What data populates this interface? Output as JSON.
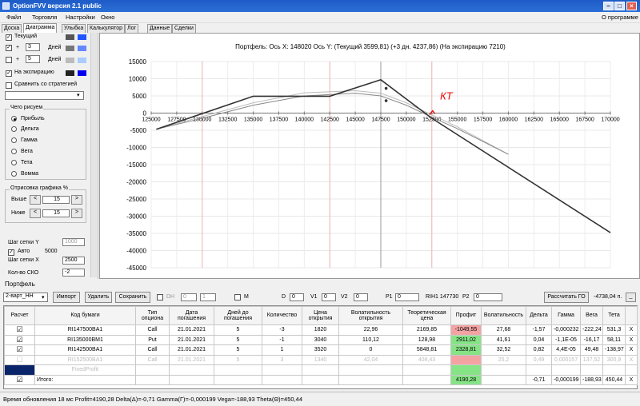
{
  "app": {
    "title": "OptionFVV версия 2.1 public"
  },
  "menu": {
    "file": "Файл",
    "trade": "Торговля",
    "settings": "Настройки",
    "window": "Окно",
    "about": "О программе"
  },
  "tabs": [
    "Доска",
    "Диаграмма",
    "Улыбка",
    "Калькулятор",
    "Лог",
    "Данные",
    "Сделки"
  ],
  "left": {
    "current_label": "Текущий",
    "plus": "+",
    "days_label": "Дней",
    "days1": "3",
    "days2": "5",
    "expiry_label": "На экспирацию",
    "compare_label": "Сравнить со стратегией",
    "compare_value": "",
    "what_draw": "Чего рисуем",
    "radio": [
      "Прибыль",
      "Дельта",
      "Гамма",
      "Вега",
      "Тета",
      "Вомма"
    ],
    "draw_pct": "Отрисовка графика %",
    "above_label": "Выше",
    "above_value": "15",
    "below_label": "Ниже",
    "below_value": "15",
    "btn_left": "<",
    "btn_right": ">",
    "grid_y_label": "Шаг сетки Y",
    "grid_y_value": "1000",
    "auto_label": "Авто",
    "auto_value": "5000",
    "grid_x_label": "Шаг сетки X",
    "grid_x_value": "2500",
    "sko_label": "Кол-во СКО",
    "sko_value": "-2",
    "colors": {
      "current": [
        "#555555",
        "#2255ff"
      ],
      "plus3": [
        "#777777",
        "#6688ff"
      ],
      "plus5": [
        "#bbbbbb",
        "#aaccff"
      ],
      "expiry": [
        "#222222",
        "#0000ee"
      ]
    }
  },
  "chart_data": {
    "type": "line",
    "title": "Портфель:  Ось X:  148020  Ось Y:   (Текущий 3599,81)  (+3 дн. 4237,86)  (На экспирацию 7210)",
    "x_ticks": [
      125000,
      127500,
      130000,
      132500,
      135000,
      137500,
      140000,
      142500,
      145000,
      147500,
      150000,
      152500,
      155000,
      157500,
      160000,
      162500,
      165000,
      167500,
      170000
    ],
    "y_ticks": [
      15000,
      10000,
      5000,
      0,
      -5000,
      -10000,
      -15000,
      -20000,
      -25000,
      -30000,
      -35000,
      -40000,
      -45000
    ],
    "xlim": [
      125000,
      170000
    ],
    "ylim": [
      -45000,
      15000
    ],
    "vlines": [
      {
        "x": 130000,
        "color": "#f3b3b3"
      },
      {
        "x": 142500,
        "color": "#f3b3b3"
      },
      {
        "x": 147500,
        "color": "#999999"
      },
      {
        "x": 152500,
        "color": "#f3b3b3"
      }
    ],
    "series": [
      {
        "color": "#333333",
        "width": 1.6,
        "x": [
          125500,
          135000,
          142500,
          147500,
          152500,
          170000
        ],
        "y": [
          -4700,
          4900,
          4900,
          9700,
          -1500,
          -34800
        ]
      },
      {
        "color": "#888888",
        "width": 1,
        "x": [
          125500,
          130000,
          135000,
          140000,
          145000,
          147500,
          150000,
          152500,
          155000,
          160000
        ],
        "y": [
          -4700,
          -1500,
          2300,
          5000,
          5800,
          5000,
          2300,
          -1200,
          -4500,
          -12000
        ]
      },
      {
        "color": "#bbbbbb",
        "width": 1,
        "x": [
          125500,
          130000,
          135000,
          140000,
          145000,
          147500,
          150000,
          152500,
          155000,
          160000
        ],
        "y": [
          -4700,
          -1000,
          3000,
          5900,
          6500,
          5800,
          3000,
          -500,
          -4000,
          -12000
        ]
      }
    ],
    "points": [
      {
        "x": 148020,
        "y": 7200
      },
      {
        "x": 148020,
        "y": 3600
      }
    ],
    "annotation": {
      "text": "КТ",
      "x": 153000,
      "y": 1200,
      "color": "#ee0000"
    }
  },
  "portfolio": {
    "label": "Портфель",
    "selected": "2-варт_НН",
    "import": "Импорт",
    "delete": "Удалить",
    "save": "Сохранить",
    "dh_label": "DH",
    "dh_v1": "0",
    "dh_v2": "1",
    "m_label": "M",
    "d_label": "D",
    "d_value": "0",
    "v1_label": "V1",
    "v1_value": "0",
    "v2_label": "V2",
    "v2_value": "0",
    "p1_label": "P1",
    "p1_value": "0",
    "rih_label": "RIH1 147730",
    "p2_label": "P2",
    "p2_value": "0",
    "calc_go": "Рассчитать ГО",
    "go_value": "-4738,04 п."
  },
  "table": {
    "headers": [
      "Расчет",
      "Код бумаги",
      "Тип опциона",
      "Дата погашения",
      "Дней до погашения",
      "Количество",
      "Цена открытия",
      "Волатильность открытия",
      "Теоретическая цена",
      "Профит",
      "Волатильность",
      "Дельта",
      "Гамма",
      "Вега",
      "Тета",
      ""
    ],
    "rows": [
      [
        "RI147500BA1",
        "Call",
        "21.01.2021",
        "5",
        "-3",
        "1820",
        "22,96",
        "2169,85",
        "-1049,55",
        "27,68",
        "-1,57",
        "-0,000232",
        "-222,24",
        "531,3"
      ],
      [
        "RI135000BM1",
        "Put",
        "21.01.2021",
        "5",
        "-1",
        "3040",
        "110,12",
        "128,98",
        "2911,02",
        "41,61",
        "0,04",
        "-1,1E-05",
        "-16,17",
        "58,11"
      ],
      [
        "RI142500BA1",
        "Call",
        "21.01.2021",
        "5",
        "1",
        "3520",
        "0",
        "5848,81",
        "2328,81",
        "32,52",
        "0,82",
        "4,4E-05",
        "49,48",
        "-138,97"
      ],
      [
        "RI152500BA1",
        "Call",
        "21.01.2021",
        "5",
        "3",
        "1340",
        "42,04",
        "408,43",
        "",
        "25,2",
        "0,49",
        "0,000157",
        "137,52",
        "300,9"
      ]
    ],
    "fixed_profit": "FixedProfit",
    "total_label": "Итого:",
    "total": [
      "4190,28",
      "-0,71",
      "-0,000199",
      "-188,93",
      "450,44"
    ],
    "close_glyph": "X"
  },
  "status": "Время обновления 18 мс  Profit=4190,28 Delta(Δ)=-0,71 Gamma(Г)=-0,000199 Vega=-188,93 Theta(Θ)=450,44"
}
